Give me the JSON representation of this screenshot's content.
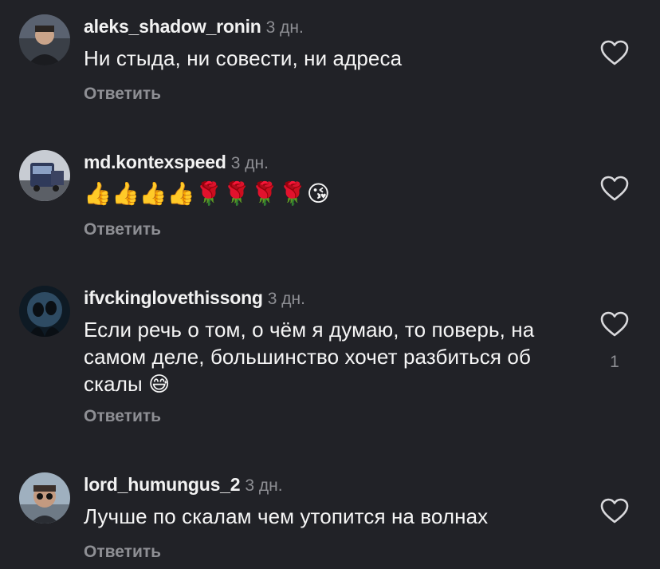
{
  "colors": {
    "background": "#212227",
    "text": "#f5f5f5",
    "muted": "#8e8f94"
  },
  "comments": [
    {
      "username": "aleks_shadow_ronin",
      "timestamp": "3 дн.",
      "text": "Ни стыда, ни совести, ни адреса",
      "reply_label": "Ответить",
      "like_icon": "heart-outline-icon",
      "likes": ""
    },
    {
      "username": "md.kontexspeed",
      "timestamp": "3 дн.",
      "text": "👍👍👍👍🌹🌹🌹🌹😘",
      "reply_label": "Ответить",
      "like_icon": "heart-outline-icon",
      "likes": ""
    },
    {
      "username": "ifvckinglovethissong",
      "timestamp": "3 дн.",
      "text": "Если речь о том, о чём я думаю, то поверь, на самом деле, большинство хочет разбиться об скалы 😅",
      "reply_label": "Ответить",
      "like_icon": "heart-outline-icon",
      "likes": "1"
    },
    {
      "username": "lord_humungus_2",
      "timestamp": "3 дн.",
      "text": "Лучше по скалам чем утопится на волнах",
      "reply_label": "Ответить",
      "like_icon": "heart-outline-icon",
      "likes": ""
    }
  ]
}
